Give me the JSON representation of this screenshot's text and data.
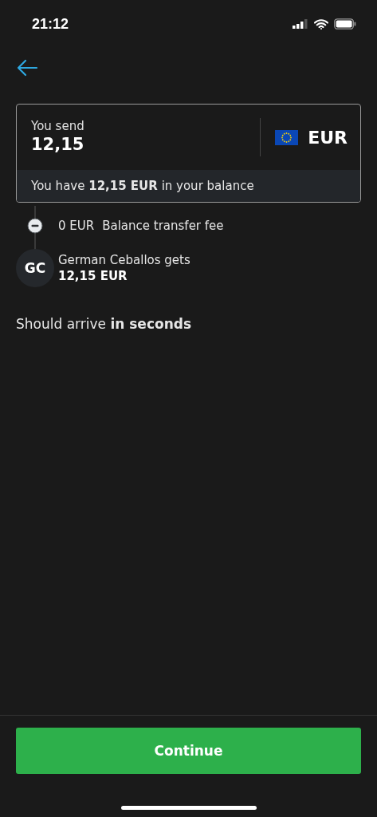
{
  "status_bar": {
    "time": "21:12"
  },
  "send": {
    "label": "You send",
    "amount": "12,15",
    "currency": "EUR",
    "balance_note": "You have **12,15 EUR** in your balance"
  },
  "fee": {
    "amount": "0 EUR",
    "label": "Balance transfer  fee"
  },
  "recipient": {
    "initials": "GC",
    "label": "German Ceballos gets",
    "amount": "12,15 EUR"
  },
  "arrival": "Should arrive **in seconds**",
  "continue_button": "Continue"
}
